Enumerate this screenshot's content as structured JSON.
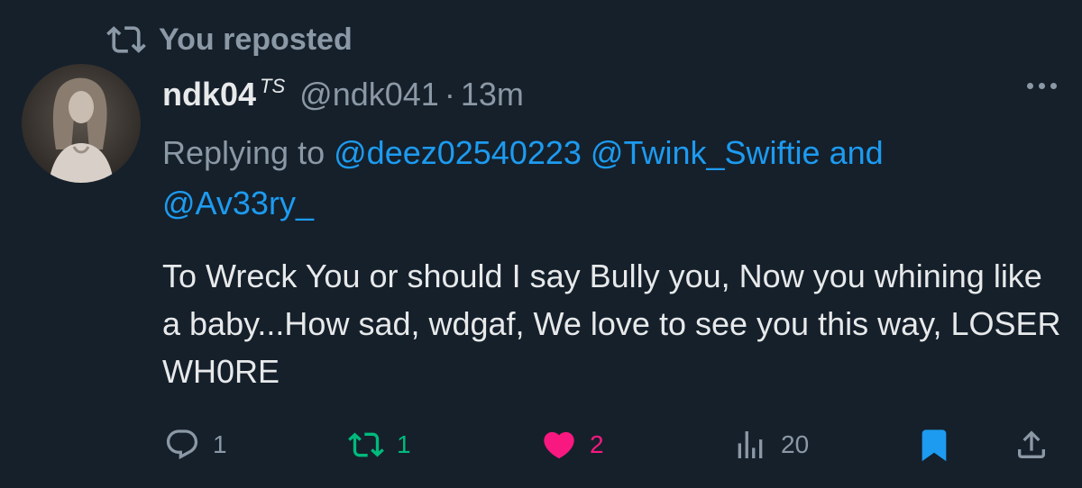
{
  "repost": {
    "label": "You reposted"
  },
  "author": {
    "name": "ndk04",
    "name_superscript": "TS",
    "handle": "@ndk041",
    "separator": "·",
    "time": "13m",
    "avatar_icon": "profile-photo"
  },
  "reply": {
    "prefix": "Replying to",
    "mention_1": "@deez02540223",
    "mention_2": "@Twink_Swiftie",
    "conjunction": "and",
    "mention_3": "@Av33ry_"
  },
  "tweet": {
    "text": "To Wreck You or should I say Bully you, Now you whining like a baby...How sad, wdgaf, We love to see you this way, LOSER WH0RE"
  },
  "actions": {
    "reply_count": "1",
    "repost_count": "1",
    "like_count": "2",
    "views_count": "20"
  },
  "colors": {
    "background": "#15202b",
    "muted": "#8b98a5",
    "link": "#1d9bf0",
    "repost_active": "#00ba7c",
    "like_active": "#f91880",
    "bookmark_active": "#1d9bf0"
  }
}
